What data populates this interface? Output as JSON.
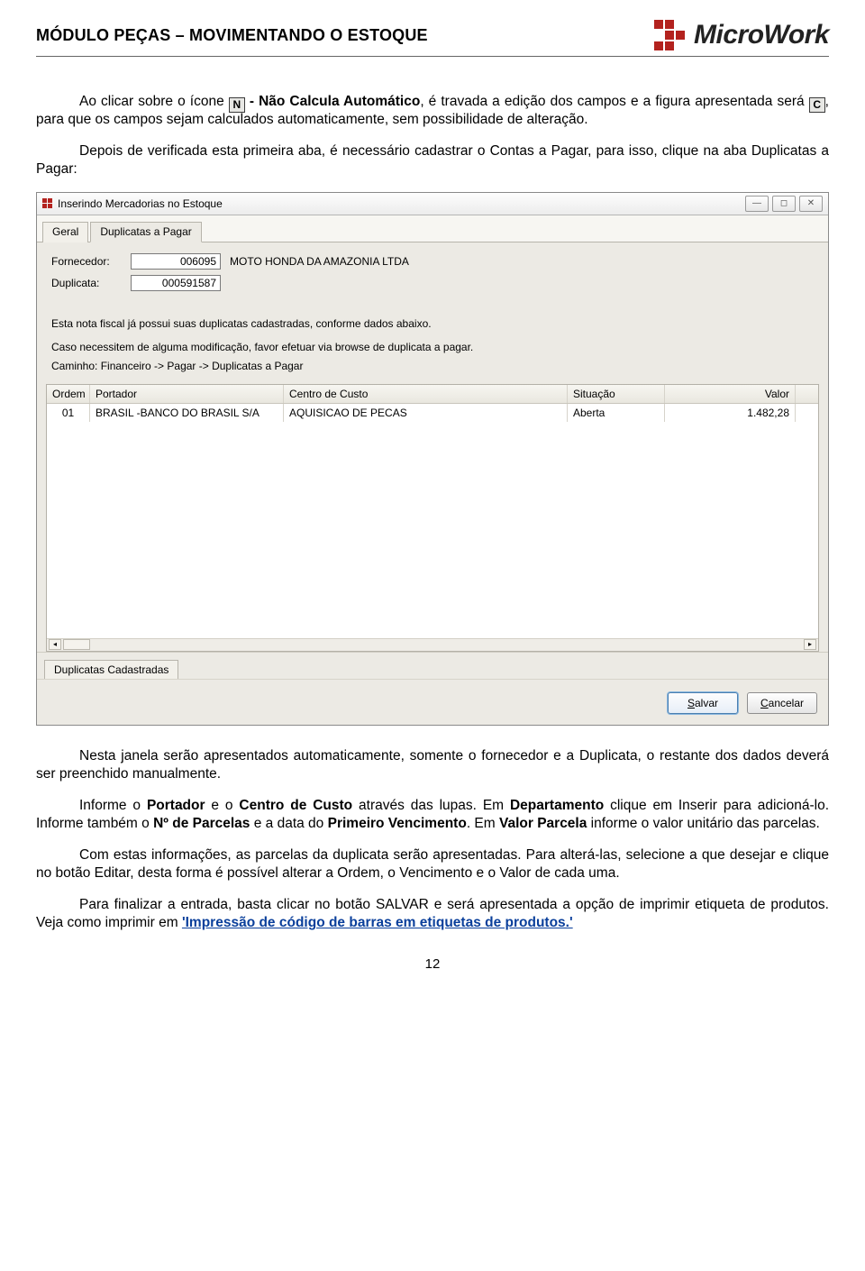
{
  "header": {
    "module_title": "MÓDULO PEÇAS – MOVIMENTANDO O ESTOQUE",
    "brand": "MicroWork"
  },
  "para1": {
    "pre": "Ao clicar sobre o ícone ",
    "icon_n": "N",
    "mid1": " - Não Calcula Automático",
    "mid2": ", é travada a edição dos campos e a figura apresentada será ",
    "icon_c": "C",
    "post": ", para que os campos sejam calculados automaticamente, sem possibilidade de alteração."
  },
  "para2": "Depois de verificada esta primeira aba, é necessário cadastrar o Contas a Pagar, para isso, clique na aba Duplicatas a Pagar:",
  "app": {
    "title": "Inserindo Mercadorias no Estoque",
    "tabs": {
      "geral": "Geral",
      "dup": "Duplicatas a Pagar"
    },
    "form": {
      "fornecedor_label": "Fornecedor:",
      "fornecedor_code": "006095",
      "fornecedor_name": "MOTO HONDA DA AMAZONIA LTDA",
      "duplicata_label": "Duplicata:",
      "duplicata_code": "000591587"
    },
    "notes": {
      "l1": "Esta nota fiscal já possui suas duplicatas cadastradas, conforme dados abaixo.",
      "l2": "Caso necessitem de alguma modificação, favor efetuar via browse de duplicata a pagar.",
      "l3": "Caminho: Financeiro -> Pagar -> Duplicatas a Pagar"
    },
    "grid": {
      "headers": {
        "ordem": "Ordem",
        "portador": "Portador",
        "centro": "Centro de Custo",
        "situacao": "Situação",
        "valor": "Valor"
      },
      "row": {
        "ordem": "01",
        "portador": "BRASIL -BANCO DO BRASIL S/A",
        "centro": "AQUISICAO DE PECAS",
        "situacao": "Aberta",
        "valor": "1.482,28"
      }
    },
    "bottom_tab": "Duplicatas Cadastradas",
    "buttons": {
      "save": "Salvar",
      "cancel": "Cancelar"
    }
  },
  "para3": "Nesta janela serão apresentados automaticamente, somente o fornecedor e a Duplicata, o restante dos dados deverá ser preenchido manualmente.",
  "para4": {
    "t1": "Informe o ",
    "b1": "Portador",
    "t2": " e o ",
    "b2": "Centro de Custo",
    "t3": " através das lupas. Em ",
    "b3": "Departamento",
    "t4": " clique em Inserir para adicioná-lo. Informe também o ",
    "b4": "Nº de Parcelas",
    "t5": " e a data do ",
    "b5": "Primeiro Vencimento",
    "t6": ". Em ",
    "b6": "Valor Parcela",
    "t7": " informe o valor unitário das parcelas."
  },
  "para5": "Com estas informações, as parcelas da duplicata serão apresentadas. Para alterá-las, selecione a que desejar e clique no botão Editar, desta forma é possível alterar a Ordem, o Vencimento e o Valor de cada uma.",
  "para6": {
    "pre": "Para finalizar a entrada, basta clicar no botão SALVAR e será apresentada a opção de imprimir etiqueta de produtos. Veja como imprimir em ",
    "link": "'Impressão de código de barras em etiquetas de produtos.'"
  },
  "page_number": "12"
}
